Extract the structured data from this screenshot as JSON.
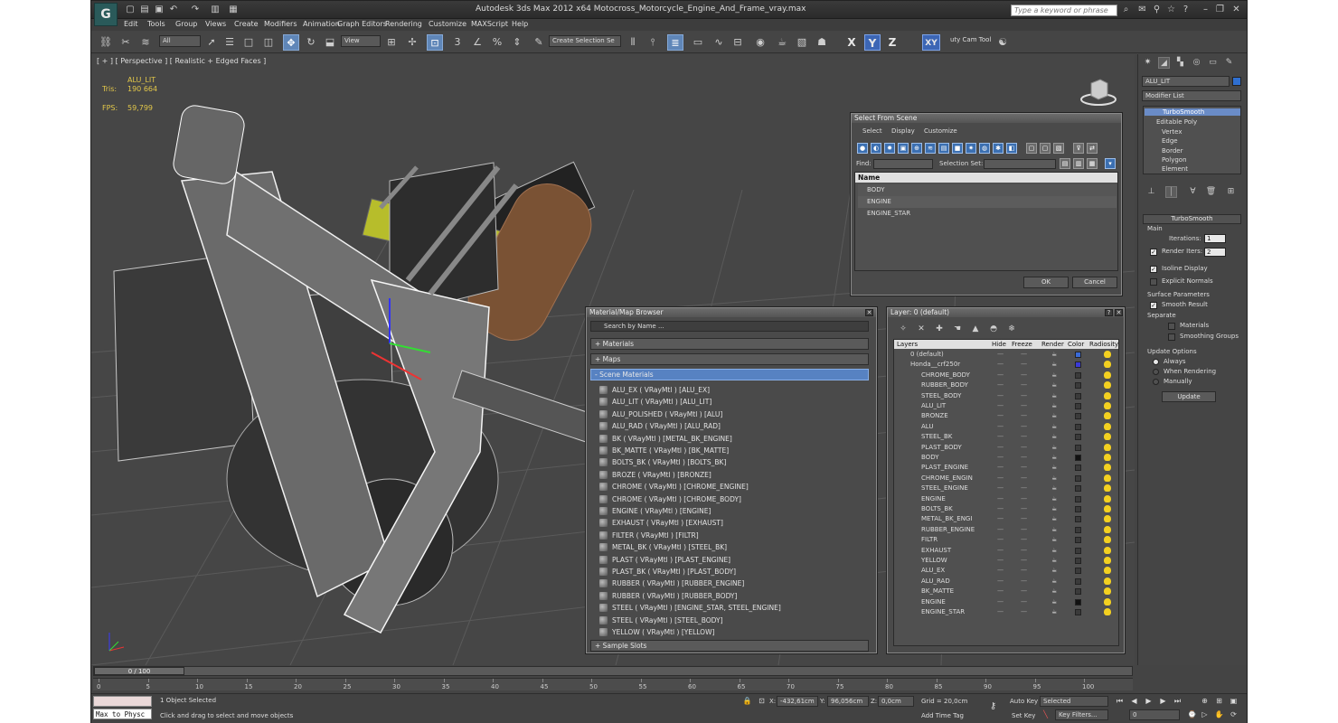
{
  "app": {
    "window_title": "Autodesk 3ds Max  2012 x64      Motocross_Motorcycle_Engine_And_Frame_vray.max",
    "search_placeholder": "Type a keyword or phrase"
  },
  "menu": [
    "Edit",
    "Tools",
    "Group",
    "Views",
    "Create",
    "Modifiers",
    "Animation",
    "Graph Editors",
    "Rendering",
    "Customize",
    "MAXScript",
    "Help"
  ],
  "toolbar": {
    "filter": "All",
    "ref_coord": "View",
    "selection_set": "Create Selection Se",
    "axis_x": "X",
    "axis_y": "Y",
    "axis_z": "Z",
    "axis_xy": "XY",
    "cam_tool": "uty Cam Tool"
  },
  "viewport": {
    "label": "[ + ] [ Perspective ] [ Realistic + Edged Faces ]",
    "obj_name": "ALU_LIT",
    "tris_label": "Tris:",
    "tris_value": "190 664",
    "fps_label": "FPS:",
    "fps_value": "59,799"
  },
  "command_panel": {
    "object_name": "ALU_LIT",
    "modifier_list": "Modifier List",
    "stack": [
      "TurboSmooth",
      "Editable Poly",
      "Vertex",
      "Edge",
      "Border",
      "Polygon",
      "Element"
    ],
    "rollout_title": "TurboSmooth",
    "main_label": "Main",
    "iterations_label": "Iterations:",
    "iterations_value": "1",
    "render_iters_label": "Render Iters:",
    "render_iters_value": "2",
    "isoline_label": "Isoline Display",
    "explicit_normals_label": "Explicit Normals",
    "surface_params_label": "Surface Parameters",
    "smooth_result_label": "Smooth Result",
    "separate_label": "Separate",
    "materials_label": "Materials",
    "smoothing_groups_label": "Smoothing Groups",
    "update_options_label": "Update Options",
    "always_label": "Always",
    "when_rendering_label": "When Rendering",
    "manually_label": "Manually",
    "update_button": "Update"
  },
  "select_from_scene": {
    "title": "Select From Scene",
    "menu": [
      "Select",
      "Display",
      "Customize"
    ],
    "find_label": "Find:",
    "selection_set_label": "Selection Set:",
    "column_name": "Name",
    "items": [
      "BODY",
      "ENGINE",
      "ENGINE_STAR"
    ],
    "ok": "OK",
    "cancel": "Cancel"
  },
  "material_browser": {
    "title": "Material/Map Browser",
    "search_placeholder": "Search by Name ...",
    "sections": [
      "+ Materials",
      "+ Maps",
      "- Scene Materials",
      "+ Sample Slots"
    ],
    "materials": [
      "ALU_EX  ( VRayMtl )  [ALU_EX]",
      "ALU_LIT  ( VRayMtl )  [ALU_LIT]",
      "ALU_POLISHED  ( VRayMtl )  [ALU]",
      "ALU_RAD  ( VRayMtl )  [ALU_RAD]",
      "BK  ( VRayMtl )  [METAL_BK_ENGINE]",
      "BK_MATTE  ( VRayMtl )  [BK_MATTE]",
      "BOLTS_BK  ( VRayMtl )  [BOLTS_BK]",
      "BROZE  ( VRayMtl )  [BRONZE]",
      "CHROME  ( VRayMtl )  [CHROME_ENGINE]",
      "CHROME  ( VRayMtl )  [CHROME_BODY]",
      "ENGINE  ( VRayMtl )  [ENGINE]",
      "EXHAUST  ( VRayMtl )  [EXHAUST]",
      "FILTER  ( VRayMtl )  [FILTR]",
      "METAL_BK  ( VRayMtl )  [STEEL_BK]",
      "PLAST  ( VRayMtl )  [PLAST_ENGINE]",
      "PLAST_BK  ( VRayMtl )  [PLAST_BODY]",
      "RUBBER  ( VRayMtl )  [RUBBER_ENGINE]",
      "RUBBER  ( VRayMtl )  [RUBBER_BODY]",
      "STEEL  ( VRayMtl )  [ENGINE_STAR, STEEL_ENGINE]",
      "STEEL  ( VRayMtl )  [STEEL_BODY]",
      "YELLOW  ( VRayMtl )  [YELLOW]"
    ]
  },
  "layer_manager": {
    "title": "Layer: 0 (default)",
    "help": "?",
    "columns": [
      "Layers",
      "Hide",
      "Freeze",
      "Render",
      "Color",
      "Radiosity"
    ],
    "layers": [
      "0 (default)",
      "Honda__crf250r",
      "CHROME_BODY",
      "RUBBER_BODY",
      "STEEL_BODY",
      "ALU_LIT",
      "BRONZE",
      "ALU",
      "STEEL_BK",
      "PLAST_BODY",
      "BODY",
      "PLAST_ENGINE",
      "CHROME_ENGIN",
      "STEEL_ENGINE",
      "ENGINE",
      "BOLTS_BK",
      "METAL_BK_ENGI",
      "RUBBER_ENGINE",
      "FILTR",
      "EXHAUST",
      "YELLOW",
      "ALU_EX",
      "ALU_RAD",
      "BK_MATTE",
      "ENGINE",
      "ENGINE_STAR"
    ],
    "dashes": "----"
  },
  "timeline": {
    "frame": "0 / 100",
    "ticks": [
      "0",
      "5",
      "10",
      "15",
      "20",
      "25",
      "30",
      "35",
      "40",
      "45",
      "50",
      "55",
      "60",
      "65",
      "70",
      "75",
      "80",
      "85",
      "90",
      "95",
      "100"
    ]
  },
  "status": {
    "listener": "Max to Physc",
    "selected": "1 Object Selected",
    "prompt": "Click and drag to select and move objects",
    "x_label": "X:",
    "x_value": "-432,61cm",
    "y_label": "Y:",
    "y_value": "96,056cm",
    "z_label": "Z:",
    "z_value": "0,0cm",
    "grid": "Grid = 20,0cm",
    "add_time_tag": "Add Time Tag",
    "auto_key": "Auto Key",
    "set_key": "Set Key",
    "key_mode": "Selected",
    "key_filters": "Key Filters...",
    "frame": "0"
  },
  "colors": {
    "accent": "#5782c2",
    "background": "#444444",
    "viewport": "#464646",
    "stats": "#e3c84a"
  }
}
